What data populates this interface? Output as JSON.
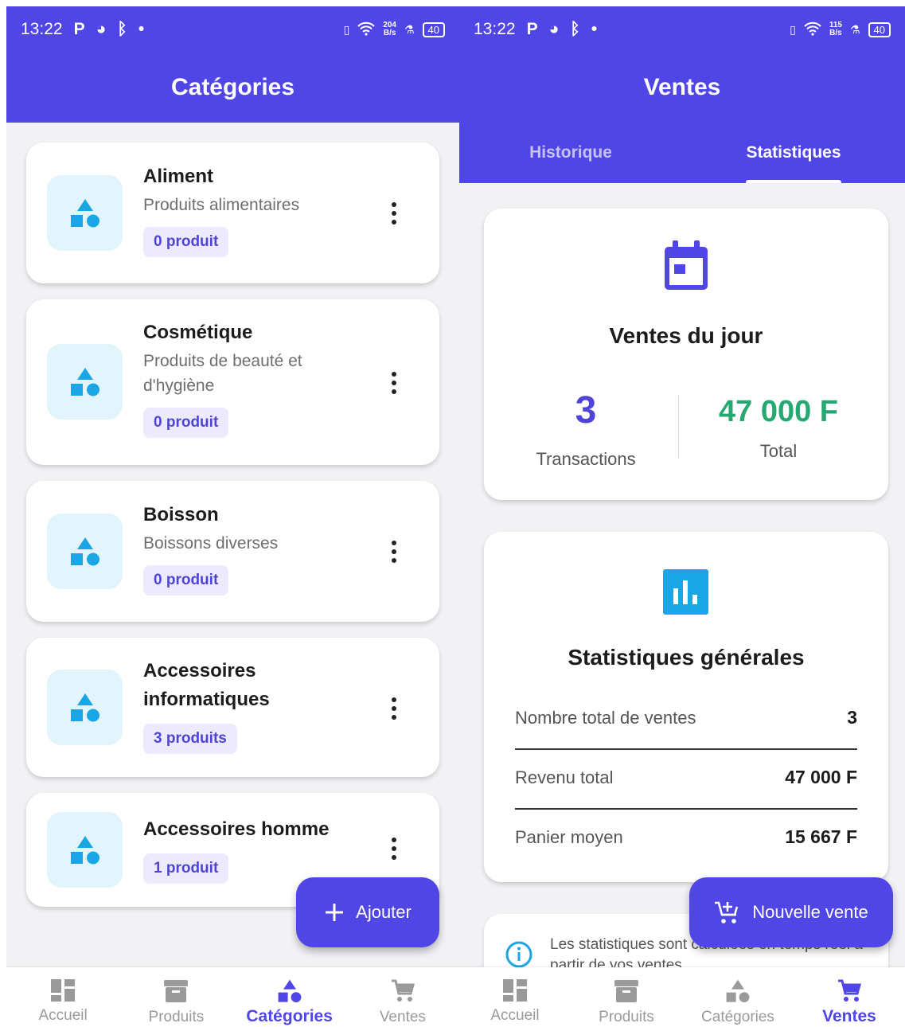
{
  "status_left": {
    "time": "13:22",
    "speed": "204",
    "speed_unit": "B/s",
    "battery": "40"
  },
  "status_right": {
    "time": "13:22",
    "speed": "115",
    "speed_unit": "B/s",
    "battery": "40"
  },
  "categories_screen": {
    "title": "Catégories",
    "items": [
      {
        "name": "Aliment",
        "description": "Produits alimentaires",
        "count": "0 produit"
      },
      {
        "name": "Cosmétique",
        "description": "Produits de beauté et d'hygiène",
        "count": "0 produit"
      },
      {
        "name": "Boisson",
        "description": "Boissons diverses",
        "count": "0 produit"
      },
      {
        "name": "Accessoires informatiques",
        "description": "",
        "count": "3 produits"
      },
      {
        "name": "Accessoires homme",
        "description": "",
        "count": "1 produit"
      }
    ],
    "fab_label": "Ajouter"
  },
  "sales_screen": {
    "title": "Ventes",
    "tabs": [
      "Historique",
      "Statistiques"
    ],
    "active_tab": "Statistiques",
    "daily": {
      "title": "Ventes du jour",
      "transactions_value": "3",
      "transactions_label": "Transactions",
      "total_value": "47 000 F",
      "total_label": "Total"
    },
    "general": {
      "title": "Statistiques générales",
      "rows": [
        {
          "label": "Nombre total de ventes",
          "value": "3"
        },
        {
          "label": "Revenu total",
          "value": "47 000 F"
        },
        {
          "label": "Panier moyen",
          "value": "15 667 F"
        }
      ]
    },
    "info_text": "Les statistiques sont calculées en temps réel à partir de vos ventes",
    "fab_label": "Nouvelle vente"
  },
  "bottom_nav": {
    "items": [
      "Accueil",
      "Produits",
      "Catégories",
      "Ventes"
    ]
  },
  "colors": {
    "primary": "#5046e5",
    "accent_green": "#25a871",
    "icon_blue": "#1aa6e4",
    "badge_bg": "#edeafd",
    "icon_bg": "#e2f5fc"
  }
}
